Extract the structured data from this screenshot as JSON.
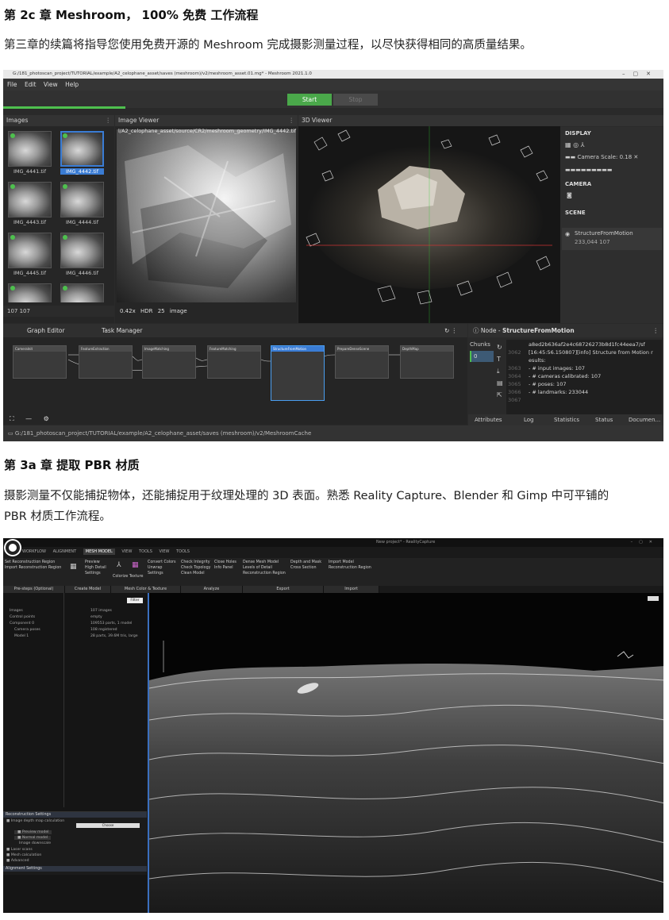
{
  "section1": {
    "heading": "第 2c 章 Meshroom， 100% 免费 工作流程",
    "desc": "第三章的续篇将指导您使用免费开源的 Meshroom 完成摄影测量过程，以尽快获得相同的高质量结果。"
  },
  "meshroom": {
    "title": "G:/181_photoscan_project/TUTORIAL/example/A2_celophane_asset/saves (meshroom)/v2/meshroom_asset.01.mg* - Meshroom 2021.1.0",
    "menu": [
      "File",
      "Edit",
      "View",
      "Help"
    ],
    "start_label": "Start",
    "stop_label": "Stop",
    "images_panel": "Images",
    "viewer_panel": "Image Viewer",
    "viewer3d_panel": "3D Viewer",
    "thumbs": [
      "IMG_4441.tif",
      "IMG_4442.tif",
      "IMG_4443.tif",
      "IMG_4444.tif",
      "IMG_4445.tif",
      "IMG_4446.tif"
    ],
    "images_footer": "107   107",
    "photo_path": "l/A2_celophane_asset/source/CR2/meshroom_geometry/IMG_4442.tif",
    "viewer_toolbar": "0.42x  HDR  25  image",
    "display_label": "DISPLAY",
    "camera_scale": "Camera Scale: 0.18",
    "camera_label": "CAMERA",
    "scene_label": "SCENE",
    "scene_item": "StructureFromMotion",
    "scene_stats": "233,044   107",
    "graph_tab": "Graph Editor",
    "task_tab": "Task Manager",
    "node_title_prefix": "Node - ",
    "node_title": "StructureFromMotion",
    "nodes": [
      "CameraInit",
      "FeatureExtraction",
      "ImageMatching",
      "FeatureMatching",
      "StructureFromMotion",
      "PrepareDenseScene",
      "DepthMap"
    ],
    "chunks_label": "Chunks",
    "chunk0": "0",
    "log_lines": [
      {
        "n": "",
        "t": "a8ed2b636af2e4c68726273b8d1fc44eea7/sf"
      },
      {
        "n": "3062",
        "t": "[16:45:56.150807][info] Structure from Motion r"
      },
      {
        "n": "",
        "t": "esults:"
      },
      {
        "n": "3063",
        "t": "     - # input images: 107"
      },
      {
        "n": "3064",
        "t": "     - # cameras calibrated: 107"
      },
      {
        "n": "3065",
        "t": "     - # poses: 107"
      },
      {
        "n": "3066",
        "t": "     - # landmarks: 233044"
      },
      {
        "n": "3067",
        "t": ""
      }
    ],
    "bottom_tabs": [
      "Attributes",
      "Log",
      "Statistics",
      "Status",
      "Documen..."
    ],
    "status_path": "G:/181_photoscan_project/TUTORIAL/example/A2_celophane_asset/saves (meshroom)/v2/MeshroomCache"
  },
  "section2": {
    "heading": "第 3a 章 提取 PBR 材质",
    "desc_line1": "摄影测量不仅能捕捉物体，还能捕捉用于纹理处理的 3D 表面。熟悉 Reality Capture、Blender 和 Gimp 中可平铺的",
    "desc_line2": "PBR 材质工作流程。"
  },
  "realitycapture": {
    "title": "New project* - RealityCapture",
    "tabs": [
      "WORKFLOW",
      "ALIGNMENT",
      "MESH MODEL",
      "VIEW",
      "TOOLS",
      "VIEW",
      "TOOLS"
    ],
    "ribbon_cols": [
      [
        "Set Reconstruction Region",
        "Import Reconstruction Region"
      ],
      [
        "Preview",
        "High Detail",
        "Settings"
      ],
      [
        "Colorize",
        "Texture"
      ],
      [
        "Convert Colors",
        "Unwrap",
        "Settings"
      ],
      [
        "Check Integrity",
        "Check Topology",
        "Clean Model"
      ],
      [
        "Close Holes",
        "Info Panel"
      ],
      [
        "Dense Mesh Model",
        "Levels of Detail",
        "Reconstruction Region"
      ],
      [
        "Depth and Mask",
        "Cross Section"
      ],
      [
        "Import Model",
        "Reconstruction Region"
      ]
    ],
    "groups": [
      "Pre-steps (Optional)",
      "Create Model",
      "Mesh Color & Texture",
      "Analyze",
      "Export",
      "Import"
    ],
    "tree": [
      {
        "k": "Images",
        "v": "107 images"
      },
      {
        "k": "Control points",
        "v": "empty"
      },
      {
        "k": "Component 0",
        "v": "109553 parts, 1 model"
      },
      {
        "k": "Camera poses",
        "v": "108 registered"
      },
      {
        "k": "Model 1",
        "v": "28 parts, 39.6M tris, large"
      }
    ],
    "settings_head": "Reconstruction Settings",
    "settings": [
      "Image depth map calculation",
      "Preview model",
      "Normal model",
      "Image downscale"
    ],
    "sections": [
      "Laser scans",
      "Mesh calculation",
      "Advanced"
    ],
    "alignment_head": "Alignment Settings"
  }
}
